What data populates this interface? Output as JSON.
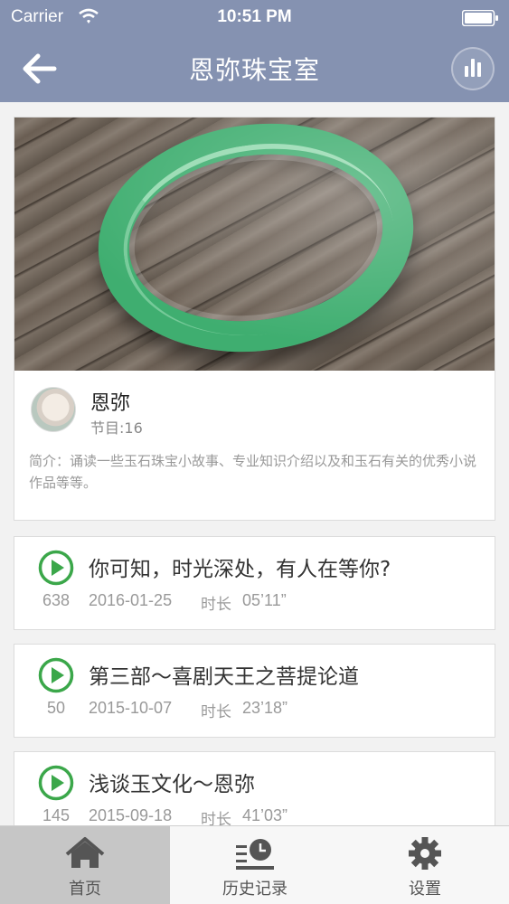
{
  "status_bar": {
    "carrier": "Carrier",
    "time": "10:51 PM"
  },
  "nav": {
    "title": "恩弥珠宝室",
    "back_icon": "arrow-left-icon",
    "player_icon": "audio-bars-icon"
  },
  "album": {
    "author_name": "恩弥",
    "program_count": "节目:16",
    "intro": "简介：诵读一些玉石珠宝小故事、专业知识介绍以及和玉石有关的优秀小说作品等等。"
  },
  "episodes": [
    {
      "title": "你可知，时光深处，有人在等你?",
      "plays": "638",
      "date": "2016-01-25",
      "duration_label": "时长",
      "duration": "05’11”"
    },
    {
      "title": "第三部～喜剧天王之菩提论道",
      "plays": "50",
      "date": "2015-10-07",
      "duration_label": "时长",
      "duration": "23’18”"
    },
    {
      "title": "浅谈玉文化～恩弥",
      "plays": "145",
      "date": "2015-09-18",
      "duration_label": "时长",
      "duration": "41’03”"
    }
  ],
  "tabs": [
    {
      "label": "首页",
      "icon": "home-icon",
      "active": true
    },
    {
      "label": "历史记录",
      "icon": "history-icon",
      "active": false
    },
    {
      "label": "设置",
      "icon": "gear-icon",
      "active": false
    }
  ],
  "colors": {
    "nav_bg": "#8592b1",
    "play_green": "#3ba74a",
    "tab_active_bg": "#c6c6c6"
  }
}
